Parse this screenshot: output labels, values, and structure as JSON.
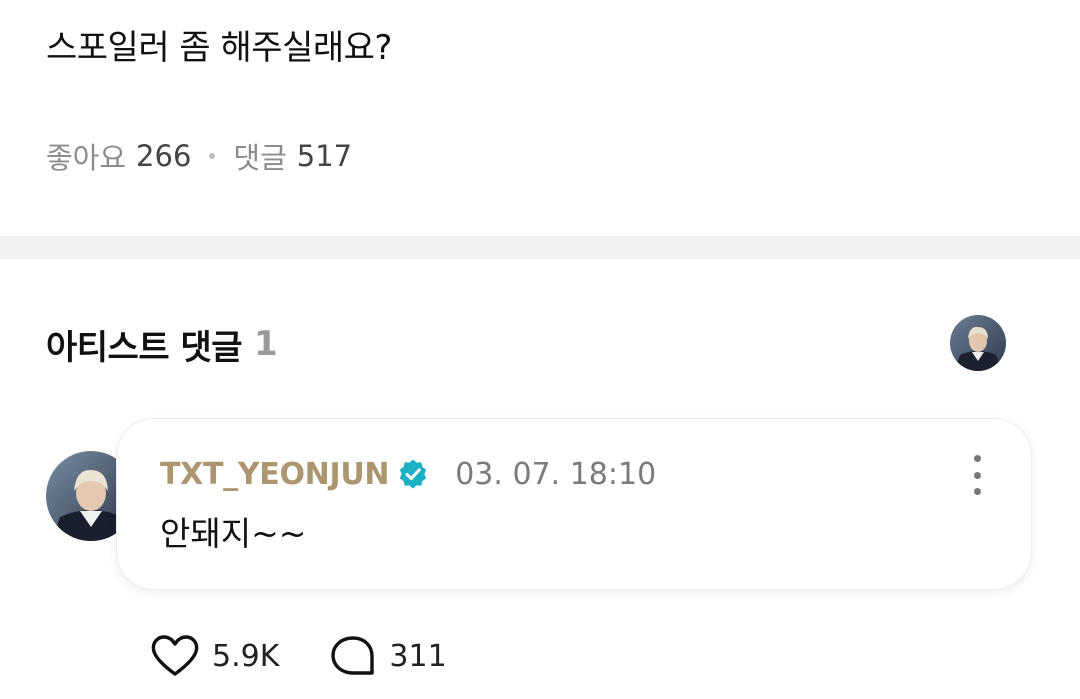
{
  "post": {
    "question": "스포일러 좀 해주실래요?",
    "likes_label": "좋아요",
    "likes_count": "266",
    "comments_label": "댓글",
    "comments_count": "517"
  },
  "artist_comments": {
    "title": "아티스트 댓글",
    "count": "1"
  },
  "comment": {
    "author": "TXT_YEONJUN",
    "timestamp": "03. 07. 18:10",
    "text": "안돼지~~",
    "likes": "5.9K",
    "replies": "311"
  },
  "colors": {
    "author": "#ac9670",
    "verified_badge": "#1ab1c4",
    "muted": "#8c8c8c",
    "divider": "#f2f2f2"
  },
  "icons": {
    "verified": "verified-badge-icon",
    "more": "more-vertical-icon",
    "like": "heart-icon",
    "reply": "speech-bubble-icon"
  }
}
